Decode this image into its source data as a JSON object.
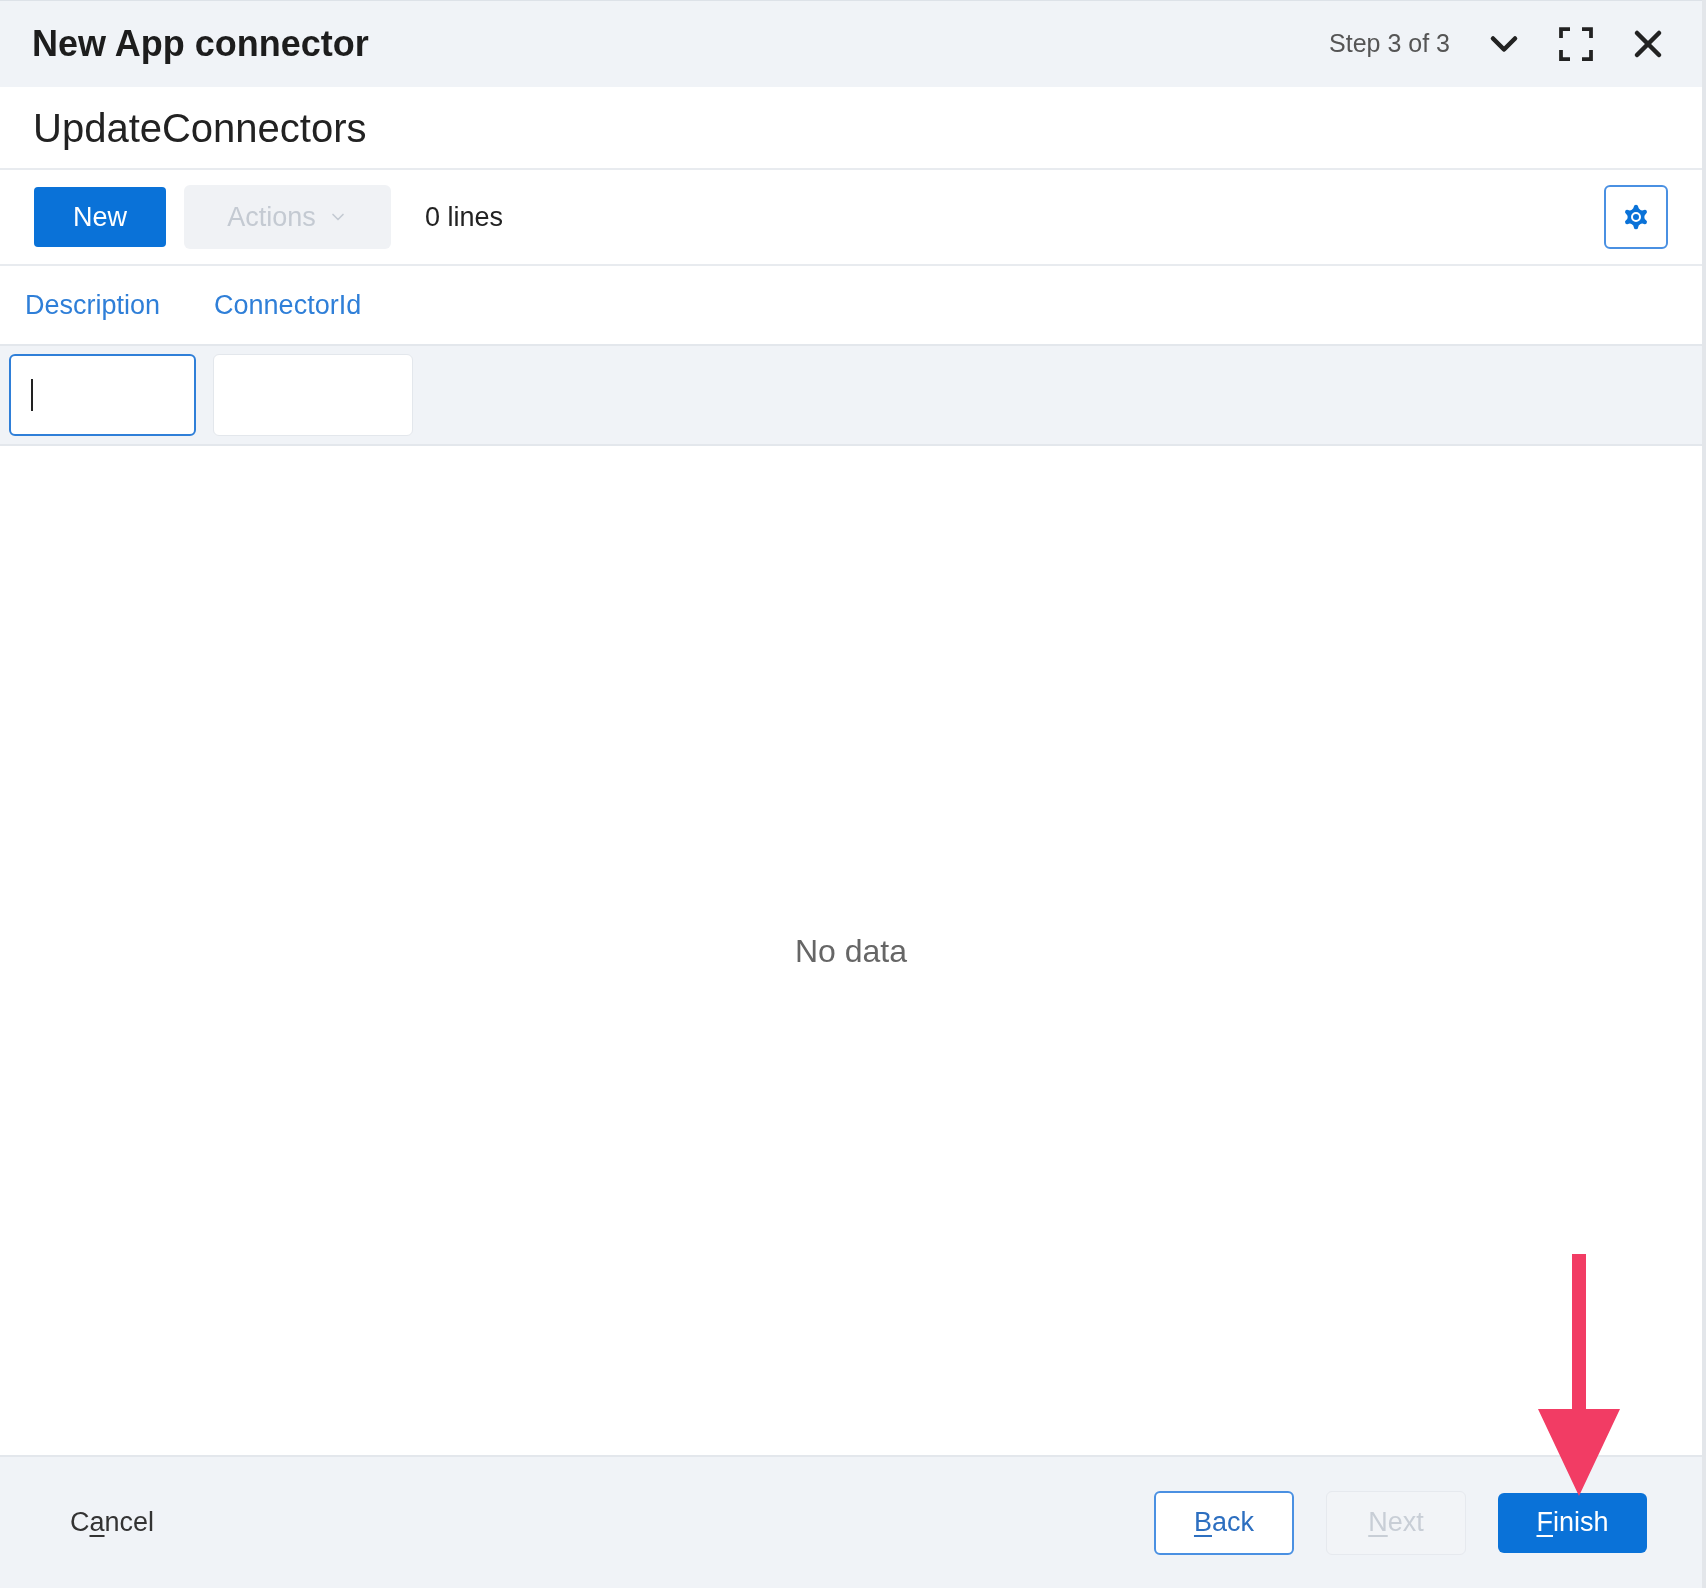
{
  "window": {
    "title": "New App connector",
    "step": "Step 3 of 3"
  },
  "subtitle": "UpdateConnectors",
  "toolbar": {
    "new_button": "New",
    "actions_button": {
      "label": "Actions",
      "disabled": true
    },
    "line_count": "0 lines"
  },
  "table": {
    "columns": [
      {
        "label": "Description",
        "focused": true
      },
      {
        "label": "ConnectorId",
        "focused": false
      }
    ],
    "empty_text": "No data"
  },
  "footer": {
    "buttons": [
      {
        "kind": "link",
        "label_before": "C",
        "access_key": "a",
        "label_after": "ncel",
        "disabled": false
      },
      {
        "kind": "outline",
        "access_key": "B",
        "label_after": "ack",
        "disabled": false
      },
      {
        "kind": "outline",
        "access_key": "N",
        "label_after": "ext",
        "disabled": true
      },
      {
        "kind": "primary",
        "access_key": "F",
        "label_after": "inish",
        "disabled": false
      }
    ]
  }
}
